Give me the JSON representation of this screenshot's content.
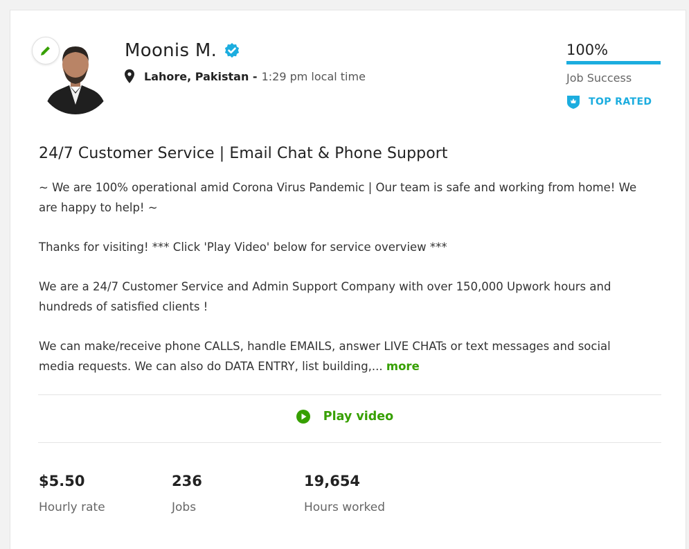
{
  "profile": {
    "name": "Moonis M.",
    "location": "Lahore, Pakistan -",
    "local_time": "1:29 pm local time"
  },
  "job_success": {
    "value": "100%",
    "label": "Job Success",
    "percent": 100
  },
  "badge": {
    "label": "TOP RATED"
  },
  "title": "24/7 Customer Service | Email Chat & Phone Support",
  "description": {
    "p1": "~ We are 100% operational amid Corona Virus Pandemic | Our team is safe and working from home! We are happy to help! ~",
    "p2": "Thanks for visiting! *** Click 'Play Video' below for service overview ***",
    "p3": "We are a 24/7 Customer Service and Admin Support Company with over 150,000 Upwork hours and hundreds of satisfied clients !",
    "p4": "We can make/receive phone CALLS, handle EMAILS, answer LIVE CHATs or text messages and social media requests. We can also do DATA ENTRY, list building,...",
    "more_label": "more"
  },
  "video": {
    "label": "Play video"
  },
  "stats": [
    {
      "value": "$5.50",
      "label": "Hourly rate"
    },
    {
      "value": "236",
      "label": "Jobs"
    },
    {
      "value": "19,654",
      "label": "Hours worked"
    }
  ],
  "colors": {
    "brand_green": "#37a000",
    "top_rated_blue": "#1caddf",
    "verified_blue": "#1caddf"
  },
  "icons": {
    "edit": "pencil-icon",
    "verified": "verified-check-icon",
    "location": "map-pin-icon",
    "top_rated": "top-rated-badge-icon",
    "play": "play-circle-icon"
  }
}
